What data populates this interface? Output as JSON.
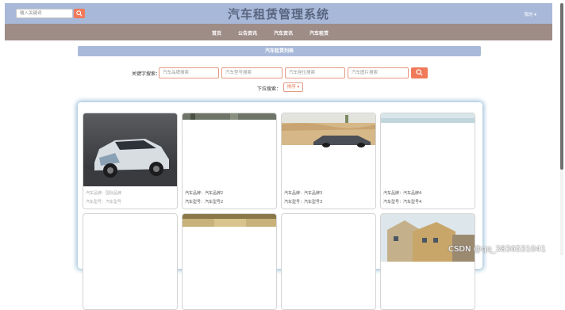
{
  "header": {
    "search_placeholder": "输入关键词",
    "search_icon": "search-icon",
    "title": "汽车租赁管理系统",
    "user_label": "我的 ▾"
  },
  "nav": {
    "items": [
      "首页",
      "公告资讯",
      "汽车资讯",
      "汽车租赁"
    ]
  },
  "section": {
    "title": "汽车租赁列表"
  },
  "filters": {
    "keyword_label": "关键字搜索：",
    "inputs": [
      "汽车品牌搜索",
      "汽车型号搜索",
      "汽车座位搜索",
      "汽车图片搜索"
    ],
    "dropdown_label": "下拉搜索：",
    "dropdown_value": "排序 ▾"
  },
  "cards": [
    {
      "brand": "汽车品牌：国际品牌",
      "model": "汽车型号：汽车型号"
    },
    {
      "brand": "汽车品牌：汽车品牌2",
      "model": "汽车型号：汽车型号2"
    },
    {
      "brand": "汽车品牌：汽车品牌3",
      "model": "汽车型号：汽车型号3"
    },
    {
      "brand": "汽车品牌：汽车品牌4",
      "model": "汽车型号：汽车型号4"
    }
  ],
  "watermark": "CSDN @qq_3836531041",
  "colors": {
    "header_bg": "#a8b8d8",
    "nav_bg": "#9e8c87",
    "accent": "#f07a5a"
  }
}
